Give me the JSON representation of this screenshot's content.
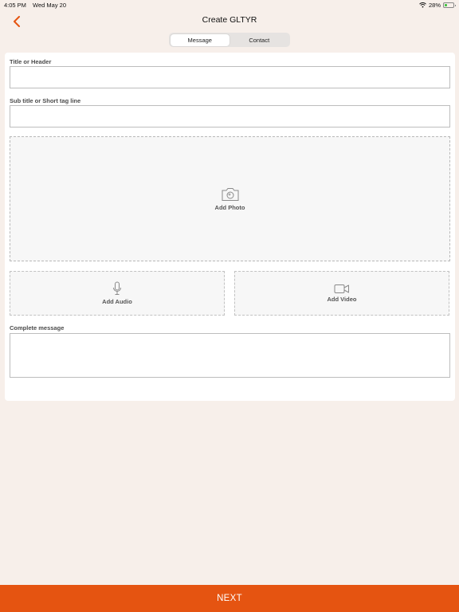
{
  "status_bar": {
    "time": "4:05 PM",
    "date": "Wed May 20",
    "battery": "28%",
    "battery_level": 0.28
  },
  "nav": {
    "title": "Create GLTYR",
    "back_icon": "chevron-left-icon"
  },
  "tabs": [
    {
      "label": "Message",
      "selected": true
    },
    {
      "label": "Contact",
      "selected": false
    }
  ],
  "form": {
    "title_label": "Title or Header",
    "title_value": "",
    "subtitle_label": "Sub title or Short tag line",
    "subtitle_value": "",
    "photo": {
      "label": "Add Photo",
      "icon": "camera-icon"
    },
    "audio": {
      "label": "Add Audio",
      "icon": "microphone-icon"
    },
    "video": {
      "label": "Add Video",
      "icon": "video-camera-icon"
    },
    "message_label": "Complete message",
    "message_value": ""
  },
  "footer": {
    "next_label": "NEXT"
  },
  "colors": {
    "accent": "#e55411",
    "background": "#f7efea",
    "card": "#ffffff"
  }
}
